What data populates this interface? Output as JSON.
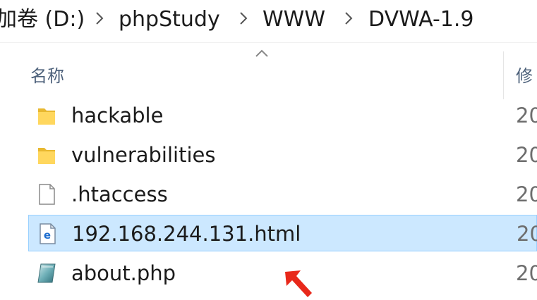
{
  "breadcrumb": {
    "segments": [
      "加卷 (D:)",
      "phpStudy",
      "WWW",
      "DVWA-1.9"
    ]
  },
  "columns": {
    "name": "名称",
    "date": "修"
  },
  "files": [
    {
      "name": "hackable",
      "icon": "folder-icon",
      "date": "20"
    },
    {
      "name": "vulnerabilities",
      "icon": "folder-icon",
      "date": "20"
    },
    {
      "name": ".htaccess",
      "icon": "file-icon",
      "date": "20"
    },
    {
      "name": "192.168.244.131.html",
      "icon": "html-file-icon",
      "date": "20",
      "selected": true
    },
    {
      "name": "about.php",
      "icon": "php-file-icon",
      "date": "20"
    }
  ],
  "colors": {
    "selection_bg": "#cce8ff",
    "selection_border": "#99d1ff",
    "folder": "#ffd75e",
    "annotation_arrow": "#e8281a"
  }
}
